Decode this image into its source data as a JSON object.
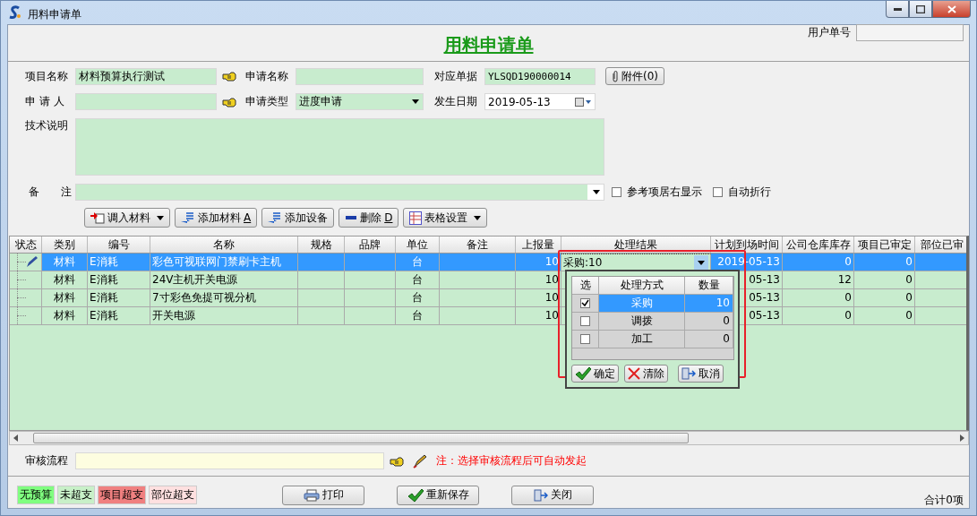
{
  "window": {
    "title": "用料申请单"
  },
  "header": {
    "title": "用料申请单",
    "user_no_label": "用户单号"
  },
  "form": {
    "row1": [
      {
        "label": "项目名称",
        "value": "材料预算执行测试",
        "kind": "picker"
      },
      {
        "label": "申请名称",
        "kind": "text"
      },
      {
        "label": "对应单据",
        "value": "YLSQD190000014",
        "kind": "text"
      }
    ],
    "attach_button": "附件(0)",
    "row2": [
      {
        "label": "申 请 人",
        "kind": "picker"
      },
      {
        "label": "申请类型",
        "value": "进度申请",
        "kind": "combo"
      },
      {
        "label": "发生日期",
        "value": "2019-05-13",
        "kind": "date"
      }
    ],
    "description_label": "技术说明",
    "remark_label": "备　　注",
    "options": [
      {
        "label": "参考项居右显示",
        "checked": false
      },
      {
        "label": "自动折行",
        "checked": false
      }
    ]
  },
  "toolbar": [
    {
      "label": "调入材料",
      "kind": "import",
      "dropdown": true
    },
    {
      "label": "添加材料",
      "mnemonic": "A",
      "kind": "add"
    },
    {
      "label": "添加设备",
      "kind": "add"
    },
    {
      "label": "删除",
      "mnemonic": "D",
      "kind": "delete"
    },
    {
      "label": "表格设置",
      "kind": "grid",
      "dropdown": true
    }
  ],
  "table": {
    "columns": [
      "状态",
      "类别",
      "编号",
      "名称",
      "规格",
      "品牌",
      "单位",
      "备注",
      "上报量",
      "处理结果",
      "计划到场时间",
      "公司仓库库存",
      "项目已审定",
      "部位已审"
    ],
    "rows": [
      {
        "selected": true,
        "category": "材料",
        "code": "E消耗",
        "name": "彩色可视联网门禁刷卡主机",
        "unit": "台",
        "reported": "10",
        "result": "采购:10",
        "planned": "2019-05-13",
        "stock": "0",
        "project_approved": "0"
      },
      {
        "selected": false,
        "category": "材料",
        "code": "E消耗",
        "name": "24V主机开关电源",
        "unit": "台",
        "reported": "10",
        "planned": "05-13",
        "stock": "12",
        "project_approved": "0"
      },
      {
        "selected": false,
        "category": "材料",
        "code": "E消耗",
        "name": "7寸彩色免提可视分机",
        "unit": "台",
        "reported": "10",
        "planned": "05-13",
        "stock": "0",
        "project_approved": "0"
      },
      {
        "selected": false,
        "category": "材料",
        "code": "E消耗",
        "name": "开关电源",
        "unit": "台",
        "reported": "10",
        "planned": "05-13",
        "stock": "0",
        "project_approved": "0"
      }
    ]
  },
  "popup": {
    "columns": [
      "选",
      "处理方式",
      "数量"
    ],
    "rows": [
      {
        "checked": true,
        "selected": true,
        "method": "采购",
        "qty": "10"
      },
      {
        "checked": false,
        "selected": false,
        "method": "调拨",
        "qty": "0"
      },
      {
        "checked": false,
        "selected": false,
        "method": "加工",
        "qty": "0"
      }
    ],
    "buttons": [
      {
        "label": "确定",
        "kind": "ok"
      },
      {
        "label": "清除",
        "kind": "clear"
      },
      {
        "label": "取消",
        "kind": "cancel"
      }
    ]
  },
  "approval": {
    "label": "审核流程",
    "note": "注：选择审核流程后可自动发起"
  },
  "legend": [
    {
      "label": "无预算",
      "color": "#80ff80"
    },
    {
      "label": "未超支",
      "color": "#c8f0c8"
    },
    {
      "label": "项目超支",
      "color": "#f08080"
    },
    {
      "label": "部位超支",
      "color": "#ffe0e0"
    }
  ],
  "buttons": [
    {
      "label": "打印",
      "kind": "print"
    },
    {
      "label": "重新保存",
      "kind": "save"
    },
    {
      "label": "关闭",
      "kind": "close"
    }
  ],
  "total": "合计0项"
}
